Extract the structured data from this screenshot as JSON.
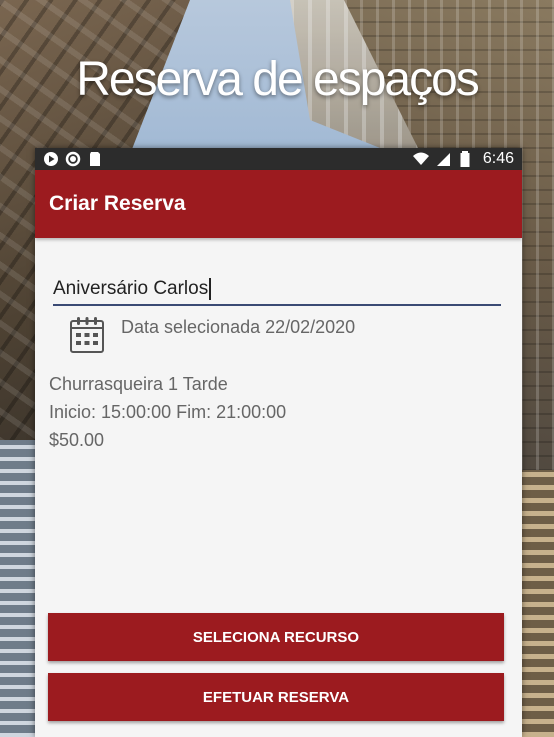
{
  "headline": "Reserva de espaços",
  "status_bar": {
    "time": "6:46",
    "icons": [
      "play-protect-icon",
      "circle-icon",
      "sd-card-icon",
      "wifi-icon",
      "signal-icon",
      "battery-icon"
    ]
  },
  "app_bar": {
    "title": "Criar Reserva"
  },
  "form": {
    "name_value": "Aniversário Carlos",
    "date_text": "Data selecionada 22/02/2020"
  },
  "resource": {
    "name": "Churrasqueira 1 Tarde",
    "schedule": "Inicio: 15:00:00 Fim: 21:00:00",
    "price": "$50.00"
  },
  "buttons": {
    "select_resource": "SELECIONA RECURSO",
    "make_booking": "EFETUAR RESERVA"
  },
  "colors": {
    "primary": "#9c1b1f",
    "status_bar": "#2c2c2c",
    "underline": "#3a4a74",
    "background": "#f5f5f5"
  }
}
